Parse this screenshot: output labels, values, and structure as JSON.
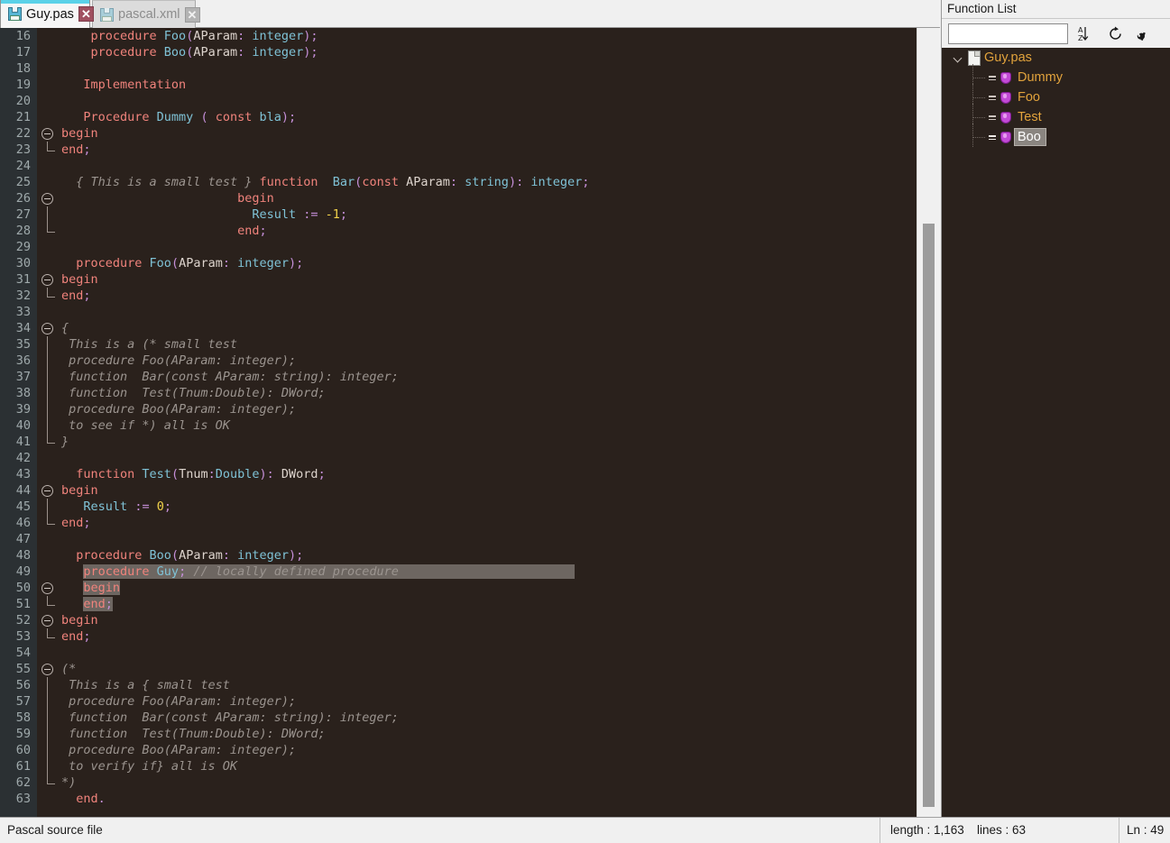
{
  "tabs": [
    {
      "title": "Guy.pas",
      "icon": "floppy-disk-icon",
      "close": "✕",
      "active": true
    },
    {
      "title": "pascal.xml",
      "icon": "floppy-disk-icon",
      "close": "✕",
      "active": false
    }
  ],
  "editor": {
    "first_line": 16,
    "font_size": "13.5px",
    "background": "#2a211c",
    "gutter_background": "#2b3033",
    "selection_color": "#6d6661",
    "colors": {
      "keyword": "#f0837c",
      "identifier": "#7fc2d6",
      "operator": "#c58fd8",
      "number": "#f2d24b",
      "comment": "#9b948f",
      "plain": "#ddd4cd"
    },
    "lines": [
      {
        "n": 16,
        "fold": "none",
        "tokens": [
          {
            "t": "    ",
            "c": "plain"
          },
          {
            "t": "procedure ",
            "c": "kw"
          },
          {
            "t": "Foo",
            "c": "id"
          },
          {
            "t": "(",
            "c": "op"
          },
          {
            "t": "AParam",
            "c": "plain"
          },
          {
            "t": ":",
            "c": "op"
          },
          {
            "t": " ",
            "c": "plain"
          },
          {
            "t": "integer",
            "c": "id"
          },
          {
            "t": ");",
            "c": "op"
          }
        ]
      },
      {
        "n": 17,
        "fold": "none",
        "tokens": [
          {
            "t": "    ",
            "c": "plain"
          },
          {
            "t": "procedure ",
            "c": "kw"
          },
          {
            "t": "Boo",
            "c": "id"
          },
          {
            "t": "(",
            "c": "op"
          },
          {
            "t": "AParam",
            "c": "plain"
          },
          {
            "t": ":",
            "c": "op"
          },
          {
            "t": " ",
            "c": "plain"
          },
          {
            "t": "integer",
            "c": "id"
          },
          {
            "t": ");",
            "c": "op"
          }
        ]
      },
      {
        "n": 18,
        "fold": "none",
        "tokens": []
      },
      {
        "n": 19,
        "fold": "none",
        "tokens": [
          {
            "t": "   ",
            "c": "plain"
          },
          {
            "t": "Implementation",
            "c": "kw"
          }
        ]
      },
      {
        "n": 20,
        "fold": "none",
        "tokens": []
      },
      {
        "n": 21,
        "fold": "none",
        "tokens": [
          {
            "t": "   ",
            "c": "plain"
          },
          {
            "t": "Procedure ",
            "c": "kw"
          },
          {
            "t": "Dummy",
            "c": "id"
          },
          {
            "t": " ",
            "c": "plain"
          },
          {
            "t": "(",
            "c": "op"
          },
          {
            "t": " ",
            "c": "plain"
          },
          {
            "t": "const",
            "c": "kw"
          },
          {
            "t": " ",
            "c": "plain"
          },
          {
            "t": "bla",
            "c": "id"
          },
          {
            "t": ");",
            "c": "op"
          }
        ]
      },
      {
        "n": 22,
        "fold": "open",
        "tokens": [
          {
            "t": "begin",
            "c": "kw"
          }
        ]
      },
      {
        "n": 23,
        "fold": "close",
        "tokens": [
          {
            "t": "end",
            "c": "kw"
          },
          {
            "t": ";",
            "c": "op"
          }
        ]
      },
      {
        "n": 24,
        "fold": "none",
        "tokens": []
      },
      {
        "n": 25,
        "fold": "none",
        "tokens": [
          {
            "t": "  ",
            "c": "plain"
          },
          {
            "t": "{ This is a small test }",
            "c": "cmt"
          },
          {
            "t": " ",
            "c": "plain"
          },
          {
            "t": "function",
            "c": "kw"
          },
          {
            "t": "  ",
            "c": "plain"
          },
          {
            "t": "Bar",
            "c": "id"
          },
          {
            "t": "(",
            "c": "op"
          },
          {
            "t": "const",
            "c": "kw"
          },
          {
            "t": " ",
            "c": "plain"
          },
          {
            "t": "AParam",
            "c": "plain"
          },
          {
            "t": ":",
            "c": "op"
          },
          {
            "t": " ",
            "c": "plain"
          },
          {
            "t": "string",
            "c": "id"
          },
          {
            "t": "):",
            "c": "op"
          },
          {
            "t": " ",
            "c": "plain"
          },
          {
            "t": "integer",
            "c": "id"
          },
          {
            "t": ";",
            "c": "op"
          }
        ]
      },
      {
        "n": 26,
        "fold": "open",
        "tokens": [
          {
            "t": "                        ",
            "c": "plain"
          },
          {
            "t": "begin",
            "c": "kw"
          }
        ]
      },
      {
        "n": 27,
        "fold": "line",
        "tokens": [
          {
            "t": "                          ",
            "c": "plain"
          },
          {
            "t": "Result",
            "c": "id"
          },
          {
            "t": " ",
            "c": "plain"
          },
          {
            "t": ":=",
            "c": "op"
          },
          {
            "t": " ",
            "c": "plain"
          },
          {
            "t": "-1",
            "c": "num"
          },
          {
            "t": ";",
            "c": "op"
          }
        ]
      },
      {
        "n": 28,
        "fold": "close",
        "tokens": [
          {
            "t": "                        ",
            "c": "plain"
          },
          {
            "t": "end",
            "c": "kw"
          },
          {
            "t": ";",
            "c": "op"
          }
        ]
      },
      {
        "n": 29,
        "fold": "none",
        "tokens": []
      },
      {
        "n": 30,
        "fold": "none",
        "tokens": [
          {
            "t": "  ",
            "c": "plain"
          },
          {
            "t": "procedure ",
            "c": "kw"
          },
          {
            "t": "Foo",
            "c": "id"
          },
          {
            "t": "(",
            "c": "op"
          },
          {
            "t": "AParam",
            "c": "plain"
          },
          {
            "t": ":",
            "c": "op"
          },
          {
            "t": " ",
            "c": "plain"
          },
          {
            "t": "integer",
            "c": "id"
          },
          {
            "t": ");",
            "c": "op"
          }
        ]
      },
      {
        "n": 31,
        "fold": "open",
        "tokens": [
          {
            "t": "begin",
            "c": "kw"
          }
        ]
      },
      {
        "n": 32,
        "fold": "close",
        "tokens": [
          {
            "t": "end",
            "c": "kw"
          },
          {
            "t": ";",
            "c": "op"
          }
        ]
      },
      {
        "n": 33,
        "fold": "none",
        "tokens": []
      },
      {
        "n": 34,
        "fold": "open",
        "tokens": [
          {
            "t": "{",
            "c": "cmt"
          }
        ]
      },
      {
        "n": 35,
        "fold": "line",
        "tokens": [
          {
            "t": " This is a (* small test",
            "c": "cmt"
          }
        ]
      },
      {
        "n": 36,
        "fold": "line",
        "tokens": [
          {
            "t": " procedure Foo(AParam: integer);",
            "c": "cmt"
          }
        ]
      },
      {
        "n": 37,
        "fold": "line",
        "tokens": [
          {
            "t": " function  Bar(const AParam: string): integer;",
            "c": "cmt"
          }
        ]
      },
      {
        "n": 38,
        "fold": "line",
        "tokens": [
          {
            "t": " function  Test(Tnum:Double): DWord;",
            "c": "cmt"
          }
        ]
      },
      {
        "n": 39,
        "fold": "line",
        "tokens": [
          {
            "t": " procedure Boo(AParam: integer);",
            "c": "cmt"
          }
        ]
      },
      {
        "n": 40,
        "fold": "line",
        "tokens": [
          {
            "t": " to see if *) all is OK",
            "c": "cmt"
          }
        ]
      },
      {
        "n": 41,
        "fold": "close",
        "tokens": [
          {
            "t": "}",
            "c": "cmt"
          }
        ]
      },
      {
        "n": 42,
        "fold": "none",
        "tokens": []
      },
      {
        "n": 43,
        "fold": "none",
        "tokens": [
          {
            "t": "  ",
            "c": "plain"
          },
          {
            "t": "function ",
            "c": "kw"
          },
          {
            "t": "Test",
            "c": "id"
          },
          {
            "t": "(",
            "c": "op"
          },
          {
            "t": "Tnum",
            "c": "plain"
          },
          {
            "t": ":",
            "c": "op"
          },
          {
            "t": "Double",
            "c": "id"
          },
          {
            "t": "):",
            "c": "op"
          },
          {
            "t": " ",
            "c": "plain"
          },
          {
            "t": "DWord",
            "c": "plain"
          },
          {
            "t": ";",
            "c": "op"
          }
        ]
      },
      {
        "n": 44,
        "fold": "open",
        "tokens": [
          {
            "t": "begin",
            "c": "kw"
          }
        ]
      },
      {
        "n": 45,
        "fold": "line",
        "tokens": [
          {
            "t": "   ",
            "c": "plain"
          },
          {
            "t": "Result",
            "c": "id"
          },
          {
            "t": " ",
            "c": "plain"
          },
          {
            "t": ":=",
            "c": "op"
          },
          {
            "t": " ",
            "c": "plain"
          },
          {
            "t": "0",
            "c": "num"
          },
          {
            "t": ";",
            "c": "op"
          }
        ]
      },
      {
        "n": 46,
        "fold": "close",
        "tokens": [
          {
            "t": "end",
            "c": "kw"
          },
          {
            "t": ";",
            "c": "op"
          }
        ]
      },
      {
        "n": 47,
        "fold": "none",
        "tokens": []
      },
      {
        "n": 48,
        "fold": "none",
        "tokens": [
          {
            "t": "  ",
            "c": "plain"
          },
          {
            "t": "procedure ",
            "c": "kw"
          },
          {
            "t": "Boo",
            "c": "id"
          },
          {
            "t": "(",
            "c": "op"
          },
          {
            "t": "AParam",
            "c": "plain"
          },
          {
            "t": ":",
            "c": "op"
          },
          {
            "t": " ",
            "c": "plain"
          },
          {
            "t": "integer",
            "c": "id"
          },
          {
            "t": ");",
            "c": "op"
          }
        ]
      },
      {
        "n": 49,
        "fold": "none",
        "selected": true,
        "sel_pad": 24,
        "tokens": [
          {
            "t": "   ",
            "c": "plain"
          },
          {
            "t": "procedure ",
            "c": "kw"
          },
          {
            "t": "Guy",
            "c": "id"
          },
          {
            "t": ";",
            "c": "op"
          },
          {
            "t": " ",
            "c": "plain"
          },
          {
            "t": "// locally defined procedure",
            "c": "cmt"
          }
        ]
      },
      {
        "n": 50,
        "fold": "open",
        "selected": true,
        "tokens": [
          {
            "t": "   ",
            "c": "plain"
          },
          {
            "t": "begin",
            "c": "kw"
          }
        ]
      },
      {
        "n": 51,
        "fold": "close",
        "selected": true,
        "tokens": [
          {
            "t": "   ",
            "c": "plain"
          },
          {
            "t": "end",
            "c": "kw"
          },
          {
            "t": ";",
            "c": "op"
          }
        ]
      },
      {
        "n": 52,
        "fold": "open",
        "tokens": [
          {
            "t": "begin",
            "c": "kw"
          }
        ]
      },
      {
        "n": 53,
        "fold": "close",
        "tokens": [
          {
            "t": "end",
            "c": "kw"
          },
          {
            "t": ";",
            "c": "op"
          }
        ]
      },
      {
        "n": 54,
        "fold": "none",
        "tokens": []
      },
      {
        "n": 55,
        "fold": "open",
        "tokens": [
          {
            "t": "(*",
            "c": "cmt"
          }
        ]
      },
      {
        "n": 56,
        "fold": "line",
        "tokens": [
          {
            "t": " This is a { small test",
            "c": "cmt"
          }
        ]
      },
      {
        "n": 57,
        "fold": "line",
        "tokens": [
          {
            "t": " procedure Foo(AParam: integer);",
            "c": "cmt"
          }
        ]
      },
      {
        "n": 58,
        "fold": "line",
        "tokens": [
          {
            "t": " function  Bar(const AParam: string): integer;",
            "c": "cmt"
          }
        ]
      },
      {
        "n": 59,
        "fold": "line",
        "tokens": [
          {
            "t": " function  Test(Tnum:Double): DWord;",
            "c": "cmt"
          }
        ]
      },
      {
        "n": 60,
        "fold": "line",
        "tokens": [
          {
            "t": " procedure Boo(AParam: integer);",
            "c": "cmt"
          }
        ]
      },
      {
        "n": 61,
        "fold": "line",
        "tokens": [
          {
            "t": " to verify if} all is OK",
            "c": "cmt"
          }
        ]
      },
      {
        "n": 62,
        "fold": "close",
        "tokens": [
          {
            "t": "*)",
            "c": "cmt"
          }
        ]
      },
      {
        "n": 63,
        "fold": "none",
        "tokens": [
          {
            "t": "  ",
            "c": "plain"
          },
          {
            "t": "end",
            "c": "kw"
          },
          {
            "t": ".",
            "c": "op"
          }
        ]
      }
    ]
  },
  "function_list": {
    "title": "Function List",
    "search_value": "",
    "search_placeholder": "",
    "buttons": [
      {
        "name": "sort-button",
        "icon": "sort-az-icon"
      },
      {
        "name": "reload-button",
        "icon": "refresh-icon"
      },
      {
        "name": "prefs-button",
        "icon": "wrench-icon"
      }
    ],
    "root": {
      "label": "Guy.pas",
      "expanded": true,
      "icon": "document-icon"
    },
    "items": [
      {
        "label": "Dummy",
        "icon": "function-gem-icon",
        "selected": false
      },
      {
        "label": "Foo",
        "icon": "function-gem-icon",
        "selected": false
      },
      {
        "label": "Test",
        "icon": "function-gem-icon",
        "selected": false
      },
      {
        "label": "Boo",
        "icon": "function-gem-icon",
        "selected": true
      }
    ]
  },
  "statusbar": {
    "doc_type": "Pascal source file",
    "length": "length : 1,163",
    "lines": "lines : 63",
    "caret": "Ln : 49"
  }
}
